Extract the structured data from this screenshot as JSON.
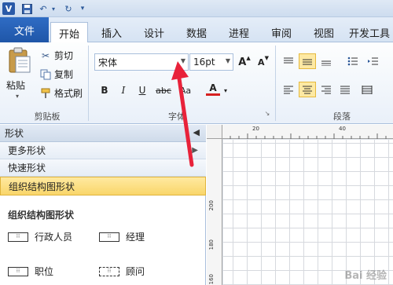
{
  "titlebar": {
    "app_icon": "V",
    "save_icon": "save-icon",
    "undo_icon": "undo-icon",
    "redo_icon": "redo-icon"
  },
  "tabs": {
    "file": "文件",
    "items": [
      "开始",
      "插入",
      "设计",
      "数据",
      "进程",
      "审阅",
      "视图",
      "开发工具"
    ],
    "active": "开始"
  },
  "clipboard": {
    "paste": "粘贴",
    "cut": "剪切",
    "copy": "复制",
    "format_painter": "格式刷",
    "group_label": "剪贴板"
  },
  "font": {
    "family": "宋体",
    "size": "16pt",
    "grow": "A",
    "shrink": "A",
    "bold": "B",
    "italic": "I",
    "underline": "U",
    "strike": "abc",
    "case": "Aa",
    "color": "A",
    "group_label": "字体"
  },
  "paragraph": {
    "group_label": "段落"
  },
  "shapes_pane": {
    "title": "形状",
    "more_shapes": "更多形状",
    "quick_shapes": "快速形状",
    "selected_stencil": "组织结构图形状",
    "stencil_title": "组织结构图形状",
    "items": [
      "行政人员",
      "经理",
      "职位",
      "顾问"
    ]
  },
  "ruler": {
    "top": [
      "20",
      "40"
    ],
    "left": [
      "200",
      "180",
      "160"
    ]
  },
  "watermark": "Bai 经验",
  "colors": {
    "accent": "#2b5797",
    "file_tab": "#2a62b8",
    "selection": "#fbd96c",
    "arrow": "#e8223a"
  }
}
